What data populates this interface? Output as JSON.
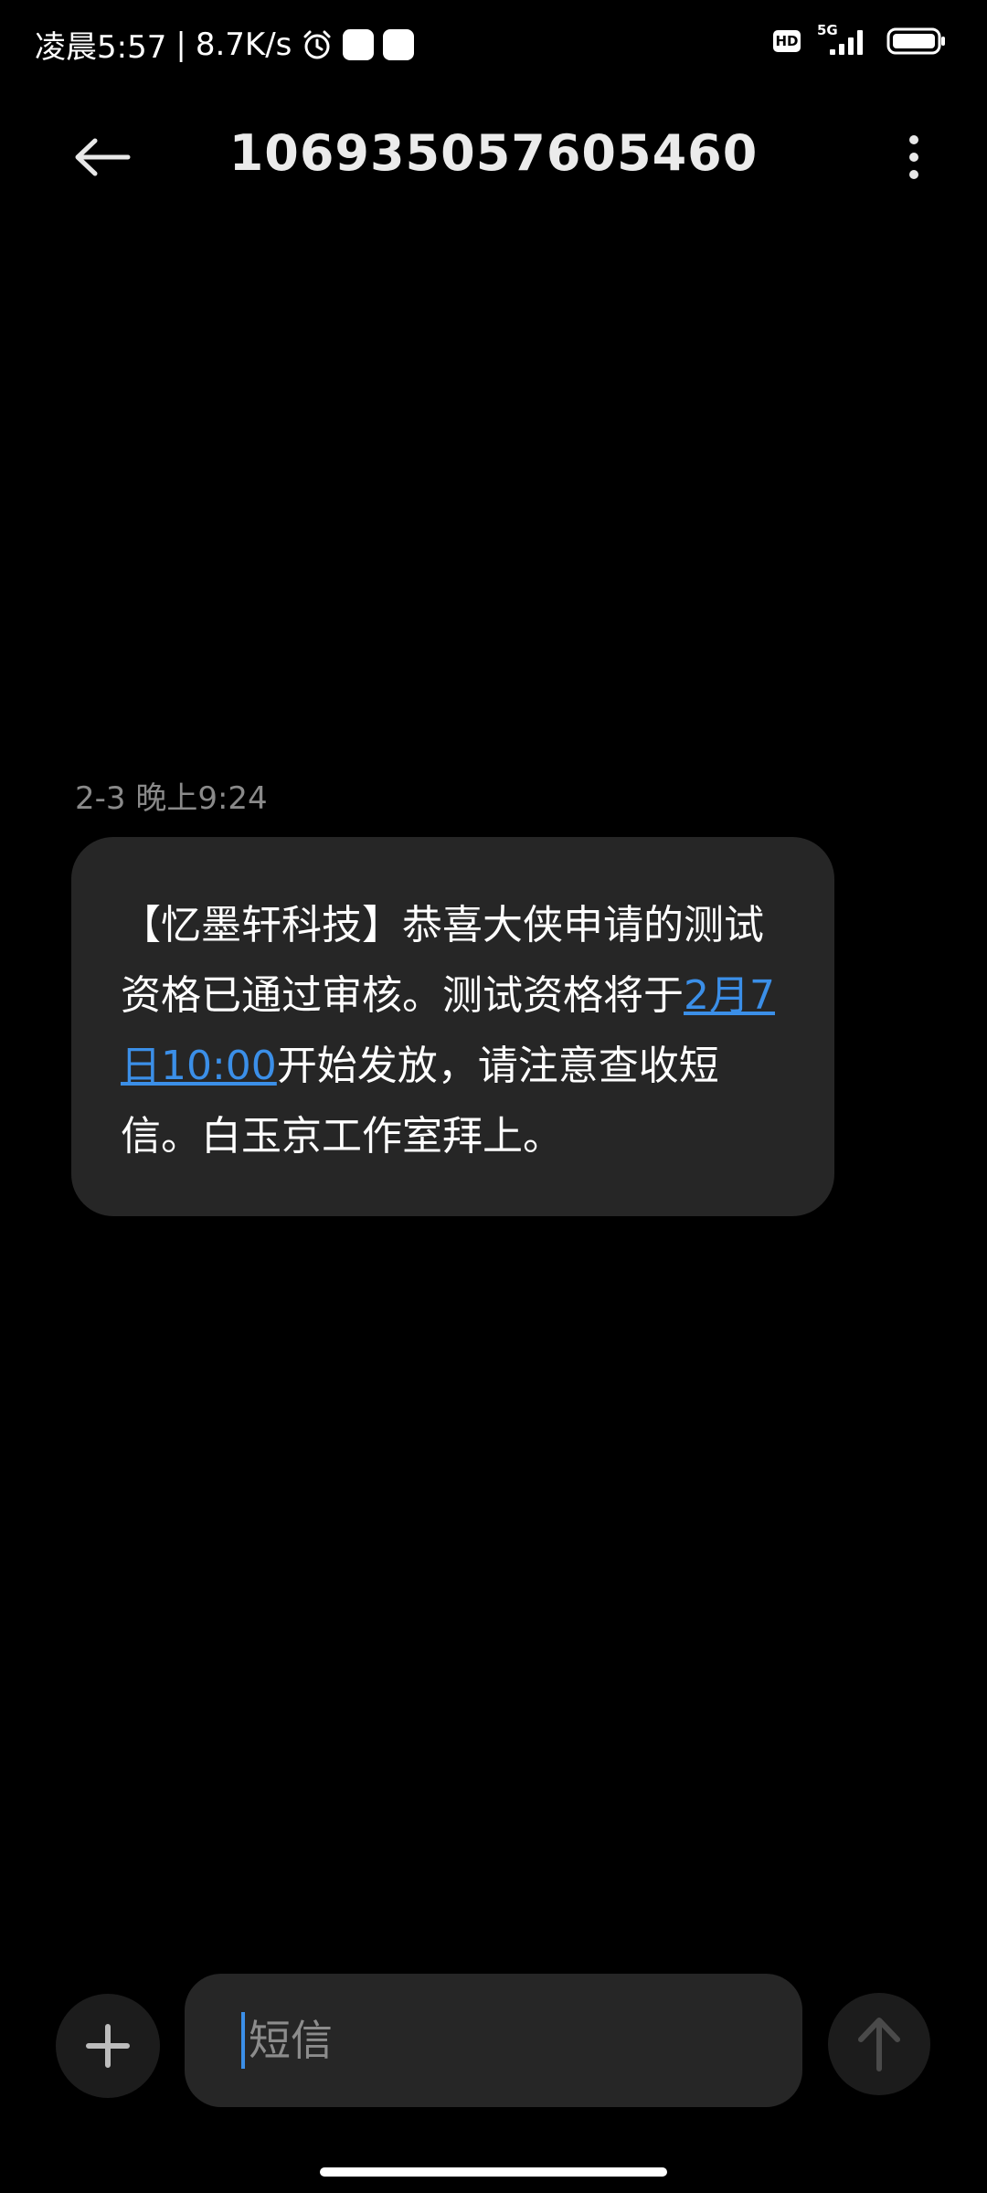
{
  "status_bar": {
    "time": "凌晨5:57",
    "separator": "|",
    "network_speed": "8.7K/s",
    "hd_label": "HD",
    "network_type": "5G",
    "icons": [
      "alarm-icon",
      "app-notification-icon",
      "app-notification-icon",
      "hd-icon",
      "signal-icon",
      "battery-icon"
    ]
  },
  "header": {
    "title": "106935057605460",
    "back_icon": "arrow-left-icon",
    "more_icon": "more-vertical-icon"
  },
  "conversation": {
    "messages": [
      {
        "timestamp": "2-3 晚上9:24",
        "text_before_link": "【忆墨轩科技】恭喜大侠申请的测试资格已通过审核。测试资格将于",
        "link_text": "2月7日10:00",
        "text_after_link": "开始发放，请注意查收短信。白玉京工作室拜上。"
      }
    ]
  },
  "compose": {
    "placeholder": "短信",
    "value": "",
    "add_icon": "plus-icon",
    "send_icon": "arrow-up-icon"
  },
  "colors": {
    "background": "#000000",
    "bubble": "#262626",
    "link": "#3b8fe8",
    "muted_text": "#8a8a8a"
  }
}
